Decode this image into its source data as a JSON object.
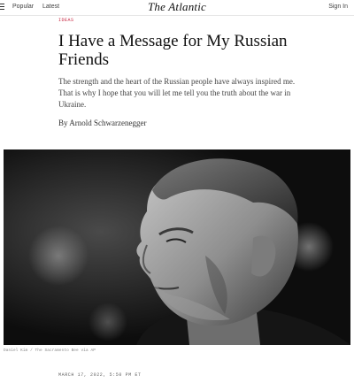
{
  "nav": {
    "menu_icon": "hamburger-menu-icon",
    "popular": "Popular",
    "latest": "Latest",
    "logo": "The Atlantic",
    "sign_in": "Sign In"
  },
  "article": {
    "section": "IDEAS",
    "headline": "I Have a Message for My Russian Friends",
    "dek": "The strength and the heart of the Russian people have always inspired me. That is why I hope that you will let me tell you the truth about the war in Ukraine.",
    "byline_prefix": "By",
    "author": "Arnold Schwarzenegger",
    "photo_credit": "Daniel Kim / The Sacramento Bee via AP",
    "date": "MARCH 17, 2022, 5:50 PM ET"
  },
  "colors": {
    "section_accent": "#c41e3a",
    "photo_bg": "#0e0e0e"
  }
}
